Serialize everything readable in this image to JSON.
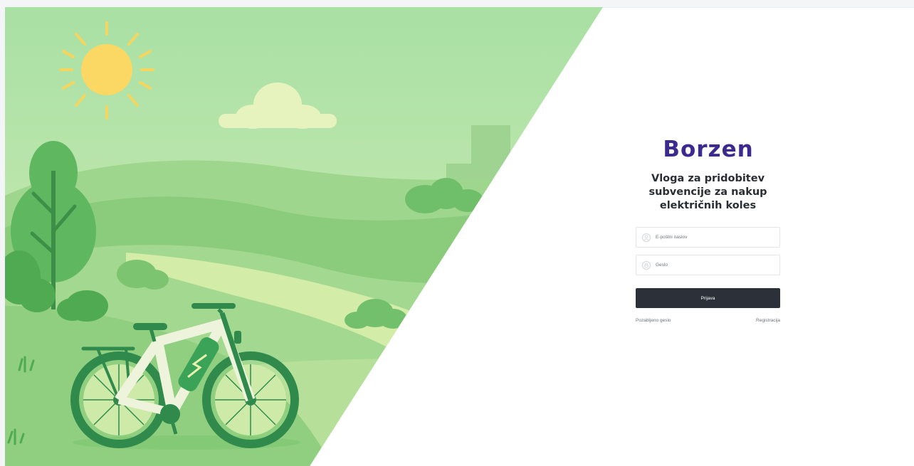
{
  "brand": {
    "logo_text": "Borzen",
    "logo_color": "#3d2a8f"
  },
  "login": {
    "title_line1": "Vloga za pridobitev",
    "title_line2": "subvencije za nakup",
    "title_line3": "električnih koles",
    "email_placeholder": "E-poštni naslov",
    "password_placeholder": "Geslo",
    "submit_label": "Prijava",
    "forgot_password_label": "Pozabljeno geslo",
    "register_label": "Registracija"
  },
  "icons": {
    "email": "user-icon",
    "password": "lock-icon"
  },
  "colors": {
    "button": "#2c3038",
    "field_border": "#e3e5e8",
    "title": "#2a2d33"
  }
}
